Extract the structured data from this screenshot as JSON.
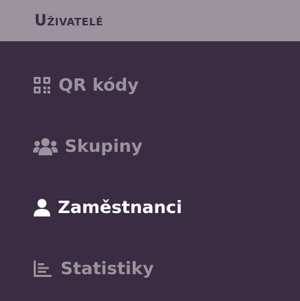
{
  "sidebar": {
    "section_title": "Uživatelé",
    "items": [
      {
        "label": "QR kódy",
        "icon": "qr-code-icon",
        "active": false
      },
      {
        "label": "Skupiny",
        "icon": "users-group-icon",
        "active": false
      },
      {
        "label": "Zaměstnanci",
        "icon": "user-icon",
        "active": true
      },
      {
        "label": "Statistiky",
        "icon": "bar-chart-icon",
        "active": false
      }
    ]
  },
  "colors": {
    "background": "#3a2c42",
    "header_background": "#9c939e",
    "inactive_text": "#9c939e",
    "active_text": "#ffffff"
  }
}
